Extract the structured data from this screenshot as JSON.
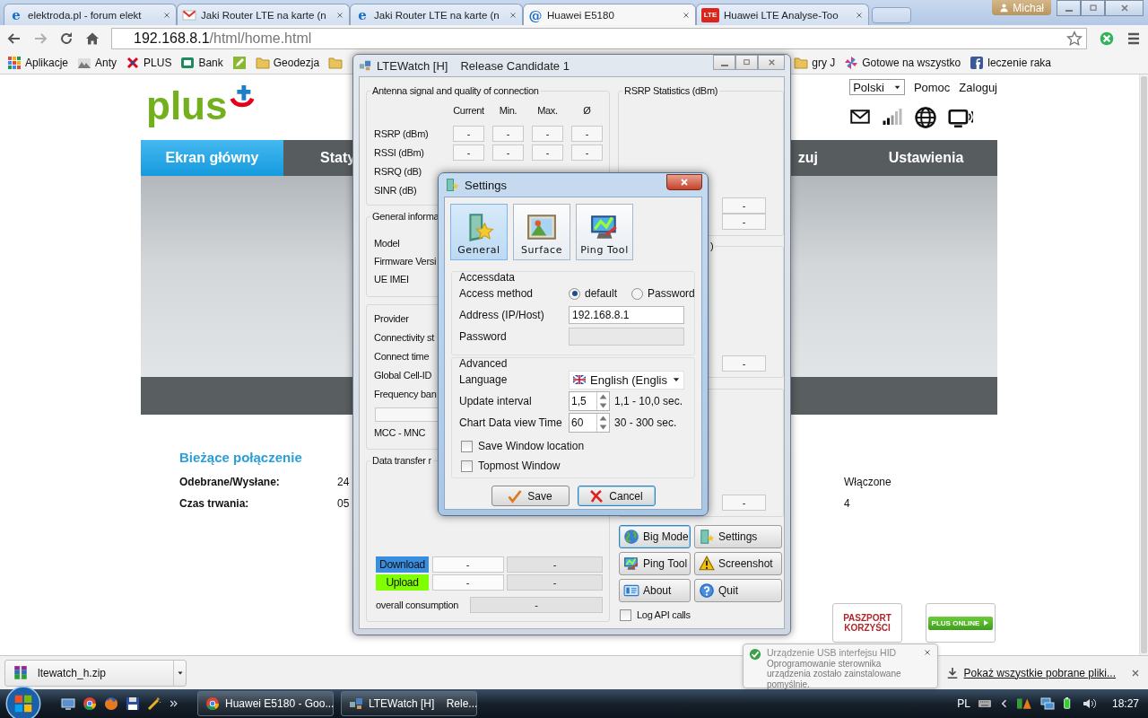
{
  "browser": {
    "tabs": [
      {
        "title": "elektroda.pl - forum elekt",
        "kind": "letter",
        "icon_text": "e",
        "selected": false
      },
      {
        "title": "Jaki Router LTE na karte (n",
        "kind": "mail",
        "selected": false
      },
      {
        "title": "Jaki Router LTE na karte (n",
        "kind": "letter",
        "icon_text": "e",
        "selected": false
      },
      {
        "title": "Huawei E5180",
        "kind": "letter",
        "icon_text": "@",
        "selected": true
      },
      {
        "title": "Huawei LTE Analyse-Too",
        "kind": "badge",
        "icon_text": "LTE",
        "selected": false
      }
    ],
    "user": "Michał",
    "address": {
      "host": "192.168.8.1",
      "path": "/html/home.html"
    },
    "bookmarks_left": [
      {
        "label": "Aplikacje",
        "kind": "apps"
      },
      {
        "label": "Anty",
        "kind": "site"
      },
      {
        "label": "PLUS",
        "kind": "plus"
      },
      {
        "label": "Bank",
        "kind": "bank"
      },
      {
        "kind": "pencil"
      },
      {
        "label": "Geodezja",
        "kind": "folder"
      },
      {
        "kind": "folder"
      }
    ],
    "bookmarks_right": [
      {
        "label": "gry J",
        "kind": "folder"
      },
      {
        "label": "Gotowe na wszystko",
        "kind": "pinwheel"
      },
      {
        "label": "leczenie raka",
        "kind": "facebook"
      }
    ]
  },
  "page": {
    "logo_text": "plus",
    "language": "Polski",
    "links": [
      "Pomoc",
      "Zaloguj"
    ],
    "nav": [
      {
        "label": "Ekran główny",
        "selected": true
      },
      {
        "label": "Staty",
        "selected": false
      },
      {
        "label": "zuj",
        "selected": false
      },
      {
        "label": "Ustawienia",
        "selected": false
      }
    ],
    "connection": {
      "heading": "Bieżące połączenie",
      "rows": [
        {
          "label": "Odebrane/Wysłane:",
          "value": "24",
          "status": "Włączone"
        },
        {
          "label": "Czas trwania:",
          "value": "05",
          "status": "4"
        }
      ]
    },
    "promos": [
      {
        "label": "PASZPORT KORZYŚCI",
        "kind": "outline"
      },
      {
        "label": "PLUS ONLINE",
        "kind": "green"
      }
    ]
  },
  "ltewatch": {
    "title": "LTEWatch [H]",
    "subtitle": "Release Candidate 1",
    "signal": {
      "title": "Antenna signal and quality of connection",
      "columns": [
        "Current",
        "Min.",
        "Max.",
        "Ø"
      ],
      "rows": [
        {
          "label": "RSRP (dBm)",
          "values": [
            "-",
            "-",
            "-",
            "-"
          ]
        },
        {
          "label": "RSSI (dBm)",
          "values": [
            "-",
            "-",
            "-",
            "-"
          ]
        },
        {
          "label": "RSRQ (dB)"
        },
        {
          "label": "SINR (dB)"
        }
      ]
    },
    "general": {
      "title": "General informa",
      "labels": [
        "Model",
        "Firmware Versi",
        "UE IMEI"
      ]
    },
    "connection": {
      "items": [
        {
          "kind": "label",
          "label": "Provider"
        },
        {
          "kind": "label",
          "label": "Connectivity st"
        },
        {
          "kind": "label",
          "label": "Connect time"
        },
        {
          "kind": "label",
          "label": "Global Cell-ID"
        },
        {
          "kind": "label",
          "label": "Frequency ban"
        },
        {
          "kind": "box"
        },
        {
          "kind": "label",
          "label": "MCC - MNC"
        }
      ]
    },
    "transfer": {
      "title": "Data transfer r",
      "rows": [
        {
          "label": "Download",
          "color": "#3a8ee0",
          "values": [
            "-",
            "-"
          ]
        },
        {
          "label": "Upload",
          "color": "#80ff00",
          "values": [
            "-",
            "-"
          ]
        }
      ],
      "overall": {
        "label": "overall consumption",
        "value": "-"
      }
    },
    "rsrp_stats": {
      "title": "RSRP Statistics (dBm)",
      "values": [
        "-",
        "-"
      ]
    },
    "group_2": {
      "title": ")",
      "values": [
        "-"
      ]
    },
    "group_3": {
      "values": [
        "-"
      ]
    },
    "buttons": [
      {
        "label": "Big Mode",
        "kind": "globe",
        "focused": true
      },
      {
        "label": "Settings",
        "kind": "door",
        "focused": false
      },
      {
        "label": "Ping Tool",
        "kind": "ping",
        "focused": false
      },
      {
        "label": "Screenshot",
        "kind": "warning",
        "focused": false
      },
      {
        "label": "About",
        "kind": "about",
        "focused": false
      },
      {
        "label": "Quit",
        "kind": "help",
        "focused": false
      }
    ],
    "log_api_calls": {
      "label": "Log API calls",
      "checked": false
    }
  },
  "settings": {
    "title": "Settings",
    "tabs": [
      {
        "label": "General",
        "kind": "starbook",
        "selected": true
      },
      {
        "label": "Surface",
        "kind": "picture",
        "selected": false
      },
      {
        "label": "Ping Tool",
        "kind": "ping",
        "selected": false
      }
    ],
    "accessdata": {
      "title": "Accessdata",
      "method_label": "Access method",
      "methods": [
        {
          "label": "default",
          "selected": true
        },
        {
          "label": "Password",
          "selected": false
        }
      ],
      "address_label": "Address (IP/Host)",
      "address": "192.168.8.1",
      "password_label": "Password",
      "password_disabled": true
    },
    "advanced": {
      "title": "Advanced",
      "language_label": "Language",
      "language": "English (Englis",
      "update_label": "Update interval",
      "update": "1,5",
      "update_range": "1,1 - 10,0 sec.",
      "chart_label": "Chart Data view Time",
      "chart": "60",
      "chart_range": "30 - 300 sec.",
      "checks": [
        {
          "label": "Save Window location",
          "checked": false
        },
        {
          "label": "Topmost Window",
          "checked": false
        }
      ]
    },
    "buttons": [
      {
        "label": "Save",
        "kind": "check",
        "focused": false
      },
      {
        "label": "Cancel",
        "kind": "cross",
        "focused": true
      }
    ]
  },
  "downloads": {
    "file": "ltewatch_h.zip",
    "show_all": "Pokaż wszystkie pobrane pliki..."
  },
  "notification": {
    "title": "Urządzenie USB interfejsu HID",
    "body": "Oprogramowanie sterownika urządzenia zostało zainstalowane pomyślnie."
  },
  "taskbar": {
    "tasks": [
      {
        "label": "Huawei E5180 - Goo...",
        "kind": "chrome"
      },
      {
        "label": "LTEWatch [H]    Rele...",
        "kind": "app"
      }
    ],
    "language": "PL",
    "clock": "18:27"
  }
}
